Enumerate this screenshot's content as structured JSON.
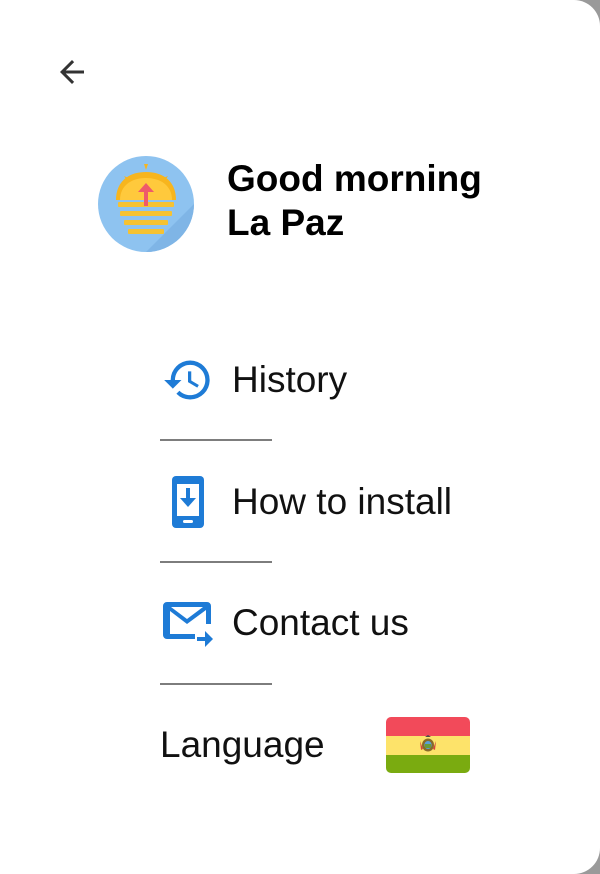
{
  "header": {
    "back_icon": "arrow-left-icon",
    "logo_icon": "sunrise-logo-icon"
  },
  "greeting": {
    "line1": "Good morning",
    "line2": "La Paz"
  },
  "menu": {
    "items": [
      {
        "label": "History",
        "icon": "history-icon"
      },
      {
        "label": "How to install",
        "icon": "phone-download-icon"
      },
      {
        "label": "Contact us",
        "icon": "mail-send-icon"
      }
    ]
  },
  "language": {
    "label": "Language",
    "flag": "bolivia-flag-icon"
  },
  "colors": {
    "accent_blue": "#1e7bd6",
    "flag_red": "#f24a5a",
    "flag_yellow": "#fde36a",
    "flag_green": "#7aab10",
    "logo_bg": "#8ec3f0",
    "logo_sun": "#f7b51e"
  }
}
